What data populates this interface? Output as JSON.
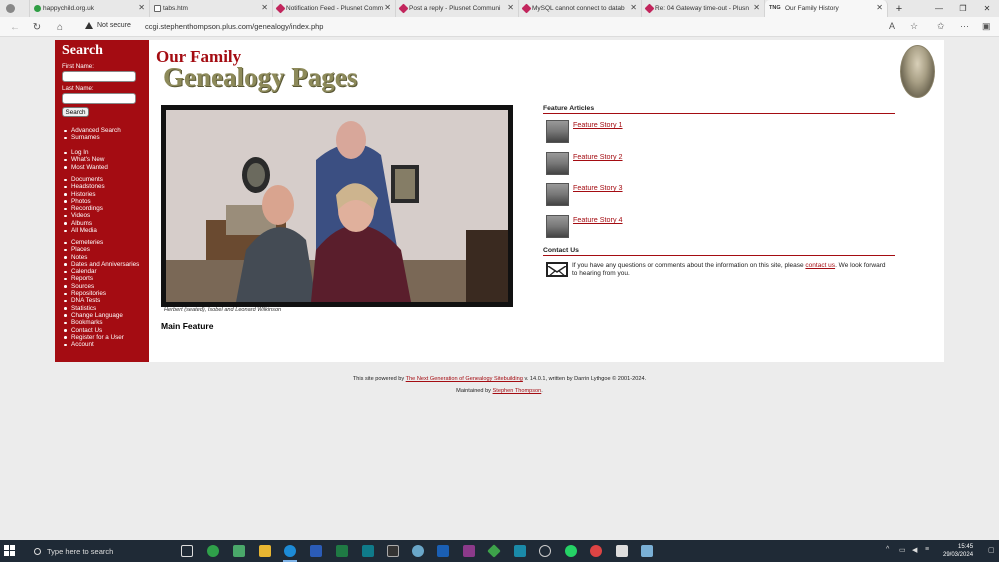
{
  "tabs": [
    {
      "title": "happychild.org.uk",
      "color": "#2f9e44"
    },
    {
      "title": "tabs.htm",
      "color": "#666666"
    },
    {
      "title": "Notification Feed - Plusnet Comm",
      "color": "#c2255c"
    },
    {
      "title": "Post a reply - Plusnet Communi",
      "color": "#c2255c"
    },
    {
      "title": "MySQL cannot connect to datab",
      "color": "#c2255c"
    },
    {
      "title": "Re: 04 Gateway time-out - Plusn",
      "color": "#c2255c"
    },
    {
      "title": "Our Family History",
      "color": "#333333",
      "favicon_text": "TNG"
    }
  ],
  "address": {
    "security_label": "Not secure",
    "url": "ccgi.stephenthompson.plus.com/genealogy/index.php"
  },
  "sidebar": {
    "title": "Search",
    "first_name_label": "First Name:",
    "last_name_label": "Last Name:",
    "search_button": "Search",
    "group1": [
      {
        "label": "Advanced Search"
      },
      {
        "label": "Surnames"
      }
    ],
    "group2": [
      {
        "label": "Log In"
      },
      {
        "label": "What's New"
      },
      {
        "label": "Most Wanted"
      }
    ],
    "group3": [
      {
        "label": "Documents"
      },
      {
        "label": "Headstones"
      },
      {
        "label": "Histories"
      },
      {
        "label": "Photos"
      },
      {
        "label": "Recordings"
      },
      {
        "label": "Videos"
      },
      {
        "label": "Albums"
      },
      {
        "label": "All Media"
      }
    ],
    "group4": [
      {
        "label": "Cemeteries"
      },
      {
        "label": "Places"
      },
      {
        "label": "Notes"
      },
      {
        "label": "Dates and Anniversaries"
      },
      {
        "label": "Calendar"
      },
      {
        "label": "Reports"
      },
      {
        "label": "Sources"
      },
      {
        "label": "Repositories"
      },
      {
        "label": "DNA Tests"
      },
      {
        "label": "Statistics"
      },
      {
        "label": "Change Language"
      },
      {
        "label": "Bookmarks"
      },
      {
        "label": "Contact Us"
      },
      {
        "label": "Register for a User"
      },
      {
        "label": "Account"
      }
    ]
  },
  "header": {
    "line1": "Our Family",
    "line2": "Genealogy Pages"
  },
  "photo": {
    "caption": "Herbert (seated), Isobel and Leonard Wilkinson"
  },
  "main_feature_label": "Main Feature",
  "features": {
    "heading": "Feature Articles",
    "stories": [
      {
        "label": "Feature Story 1"
      },
      {
        "label": "Feature Story 2"
      },
      {
        "label": "Feature Story 3"
      },
      {
        "label": "Feature Story 4"
      }
    ]
  },
  "contact": {
    "heading": "Contact Us",
    "text_before": "If you have any questions or comments about the information on this site, please ",
    "link": "contact us",
    "text_after": ". We look forward to hearing from you."
  },
  "footer": {
    "line1_before": "This site powered by ",
    "line1_link": "The Next Generation of Genealogy Sitebuilding",
    "line1_after": " v. 14.0.1, written by Darrin Lythgoe © 2001-2024.",
    "line2_before": "Maintained by ",
    "line2_link": "Stephen Thompson",
    "line2_after": "."
  },
  "taskbar": {
    "search_placeholder": "Type here to search",
    "time": "15:45",
    "date": "29/03/2024"
  }
}
